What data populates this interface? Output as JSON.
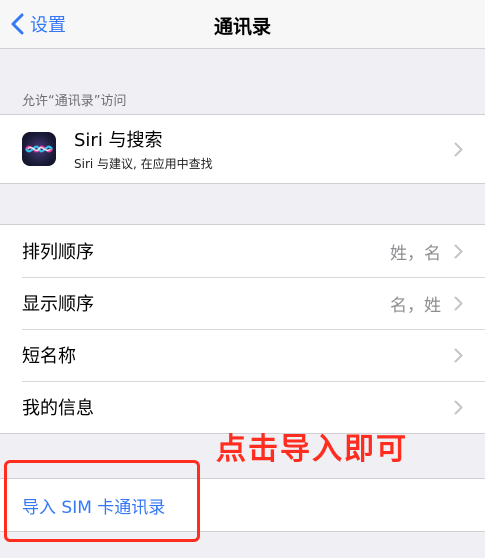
{
  "nav": {
    "back_label": "设置",
    "title": "通讯录"
  },
  "section_header": "允许“通讯录”访问",
  "siri": {
    "title": "Siri 与搜索",
    "subtitle": "Siri 与建议, 在应用中查找"
  },
  "settings": {
    "sort_order": {
      "label": "排列顺序",
      "value": "姓，名"
    },
    "display_order": {
      "label": "显示顺序",
      "value": "名，姓"
    },
    "short_name": {
      "label": "短名称"
    },
    "my_info": {
      "label": "我的信息"
    }
  },
  "import_sim": {
    "label": "导入 SIM 卡通讯录"
  },
  "annotation": {
    "text": "点击导入即可",
    "color": "#ff2d20"
  },
  "colors": {
    "accent": "#3478f6",
    "background": "#efeff4"
  }
}
